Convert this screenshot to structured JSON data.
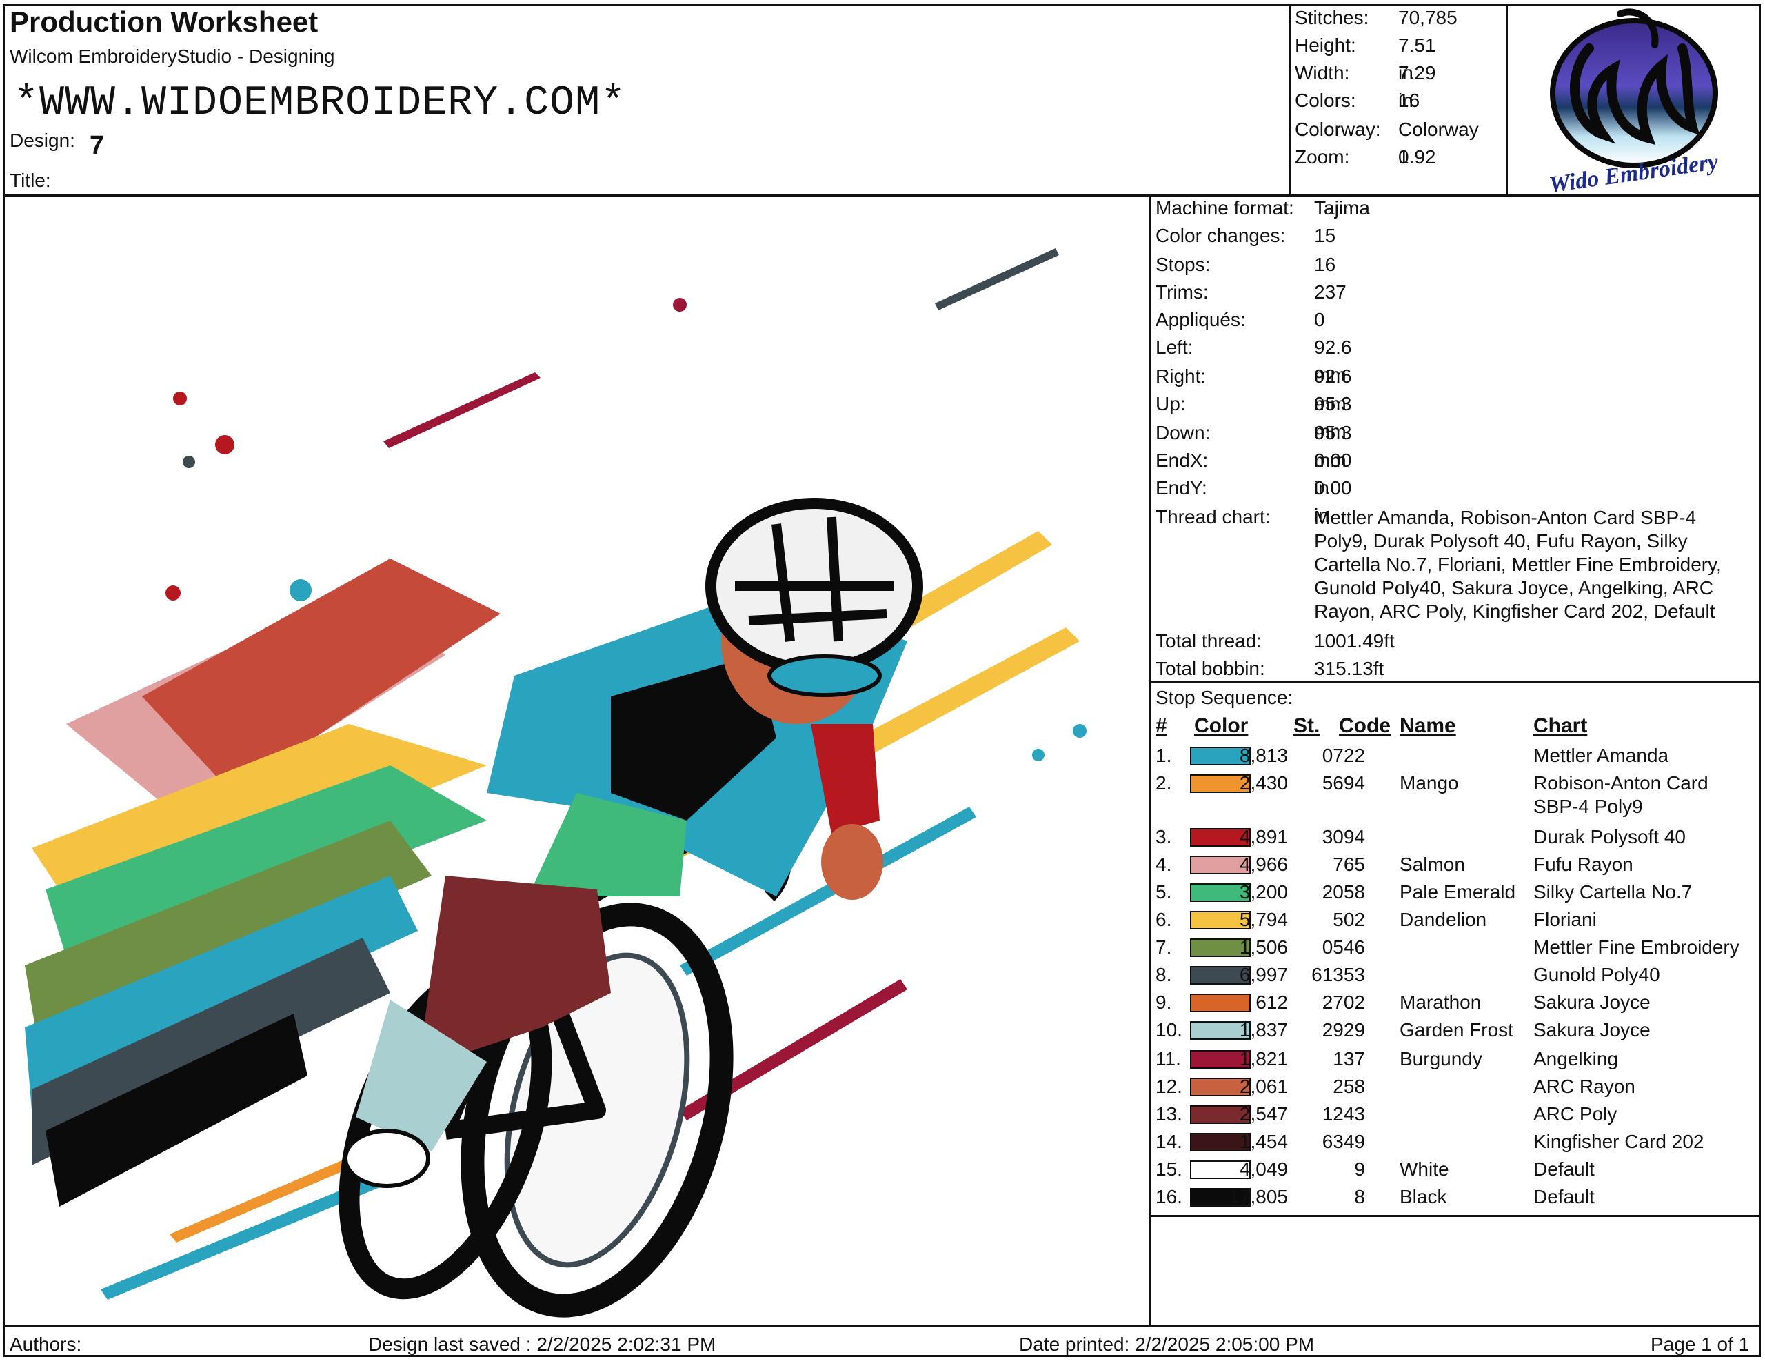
{
  "header": {
    "title": "Production Worksheet",
    "software": "Wilcom EmbroideryStudio - Designing",
    "website": "*WWW.WIDOEMBROIDERY.COM*",
    "design_label": "Design:",
    "design_value": "7",
    "title_label": "Title:"
  },
  "summary": [
    {
      "label": "Stitches:",
      "value": "70,785"
    },
    {
      "label": "Height:",
      "value": "7.51 in"
    },
    {
      "label": "Width:",
      "value": "7.29 in"
    },
    {
      "label": "Colors:",
      "value": "16"
    },
    {
      "label": "Colorway:",
      "value": "Colorway 1"
    },
    {
      "label": "Zoom:",
      "value": "0.92"
    }
  ],
  "logo": {
    "text": "Wido Embroidery",
    "icon": "wido-logo-icon"
  },
  "machine_info": [
    {
      "label": "Machine format:",
      "value": "Tajima"
    },
    {
      "label": "Color changes:",
      "value": "15"
    },
    {
      "label": "Stops:",
      "value": "16"
    },
    {
      "label": "Trims:",
      "value": "237"
    },
    {
      "label": "Appliqués:",
      "value": "0"
    },
    {
      "label": "Left:",
      "value": "92.6 mm"
    },
    {
      "label": "Right:",
      "value": "92.6 mm"
    },
    {
      "label": "Up:",
      "value": "95.3 mm"
    },
    {
      "label": "Down:",
      "value": "95.3 mm"
    },
    {
      "label": "EndX:",
      "value": "0.00 in"
    },
    {
      "label": "EndY:",
      "value": "0.00 in"
    }
  ],
  "thread_chart": {
    "label": "Thread chart:",
    "lines": [
      "Mettler Amanda, Robison-Anton Card SBP-4",
      "Poly9, Durak Polysoft 40, Fufu Rayon, Silky",
      "Cartella No.7, Floriani, Mettler Fine Embroidery,",
      "Gunold Poly40, Sakura Joyce, Angelking, ARC",
      "Rayon, ARC Poly, Kingfisher Card 202, Default"
    ]
  },
  "totals": [
    {
      "label": "Total thread:",
      "value": "1001.49ft"
    },
    {
      "label": "Total bobbin:",
      "value": "315.13ft"
    }
  ],
  "stop_sequence": {
    "title": "Stop Sequence:",
    "headers": {
      "num": "#",
      "color": "Color",
      "st": "St.",
      "code": "Code",
      "name": "Name",
      "chart": "Chart"
    },
    "rows": [
      {
        "num": "1.",
        "color": "#2aa3bf",
        "st": "8,813",
        "code": "0722",
        "name": "",
        "chart": "Mettler Amanda"
      },
      {
        "num": "2.",
        "color": "#f0952e",
        "st": "2,430",
        "code": "5694",
        "name": "Mango",
        "chart": "Robison-Anton Card",
        "chart2": "SBP-4 Poly9"
      },
      {
        "num": "3.",
        "color": "#b5181f",
        "st": "4,891",
        "code": "3094",
        "name": "",
        "chart": "Durak Polysoft 40"
      },
      {
        "num": "4.",
        "color": "#e0a0a0",
        "st": "4,966",
        "code": "765",
        "name": "Salmon",
        "chart": "Fufu Rayon"
      },
      {
        "num": "5.",
        "color": "#3fba7a",
        "st": "3,200",
        "code": "2058",
        "name": "Pale Emerald",
        "chart": "Silky Cartella No.7"
      },
      {
        "num": "6.",
        "color": "#f5c242",
        "st": "5,794",
        "code": "502",
        "name": "Dandelion",
        "chart": "Floriani"
      },
      {
        "num": "7.",
        "color": "#6f8f44",
        "st": "1,506",
        "code": "0546",
        "name": "",
        "chart": "Mettler Fine Embroidery"
      },
      {
        "num": "8.",
        "color": "#3e4a52",
        "st": "6,997",
        "code": "61353",
        "name": "",
        "chart": "Gunold Poly40"
      },
      {
        "num": "9.",
        "color": "#d8642a",
        "st": "612",
        "code": "2702",
        "name": "Marathon",
        "chart": "Sakura Joyce"
      },
      {
        "num": "10.",
        "color": "#a9cfd0",
        "st": "1,837",
        "code": "2929",
        "name": "Garden Frost",
        "chart": "Sakura Joyce"
      },
      {
        "num": "11.",
        "color": "#9c1638",
        "st": "1,821",
        "code": "137",
        "name": "Burgundy",
        "chart": "Angelking"
      },
      {
        "num": "12.",
        "color": "#c8613f",
        "st": "2,061",
        "code": "258",
        "name": "",
        "chart": "ARC Rayon"
      },
      {
        "num": "13.",
        "color": "#7a2a2c",
        "st": "2,547",
        "code": "1243",
        "name": "",
        "chart": "ARC Poly"
      },
      {
        "num": "14.",
        "color": "#3a1416",
        "st": "1,454",
        "code": "6349",
        "name": "",
        "chart": "Kingfisher Card 202"
      },
      {
        "num": "15.",
        "color": "#ffffff",
        "st": "4,049",
        "code": "9",
        "name": "White",
        "chart": "Default"
      },
      {
        "num": "16.",
        "color": "#0b0b0b",
        "st": "17,805",
        "code": "8",
        "name": "Black",
        "chart": "Default"
      }
    ]
  },
  "footer": {
    "authors": "Authors:",
    "saved": "Design last saved : 2/2/2025 2:02:31 PM",
    "printed": "Date printed: 2/2/2025 2:05:00 PM",
    "page": "Page 1 of 1"
  }
}
